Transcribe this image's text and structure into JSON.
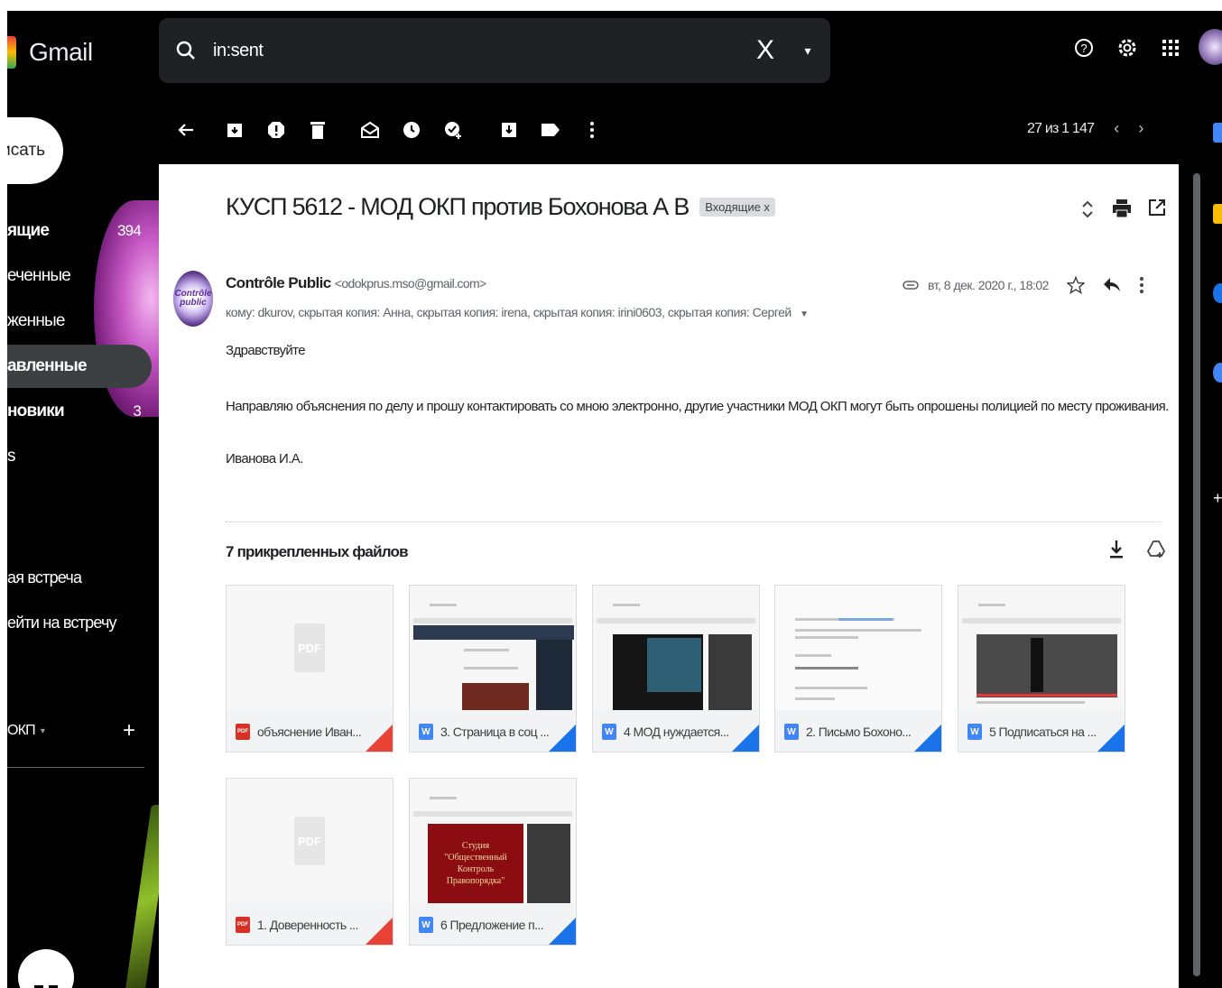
{
  "app": {
    "logo": "Gmail",
    "search": {
      "value": "in:sent",
      "clear": "X",
      "dropdown": "▾"
    }
  },
  "sidebar": {
    "compose": "исать",
    "items": [
      {
        "label": "ящие",
        "count": "394"
      },
      {
        "label": "еченные",
        "count": ""
      },
      {
        "label": "женные",
        "count": ""
      },
      {
        "label": "авленные",
        "count": ""
      },
      {
        "label": "новики",
        "count": "3"
      },
      {
        "label": "s",
        "count": ""
      }
    ],
    "meet": [
      "ая встреча",
      "ейти на встречу"
    ],
    "labels_section": {
      "label": "ОКП",
      "caret": "▾",
      "add": "+"
    }
  },
  "toolbar": {
    "pager_text": "27 из 1 147",
    "prev": "‹",
    "next": "›"
  },
  "email": {
    "subject": "КУСП 5612 - МОД ОКП против Бохонова А В",
    "label_chip": "Входящие x",
    "sender_avatar_text": [
      "Contrôle",
      "public"
    ],
    "sender_name": "Contrôle Public",
    "sender_email": "<odokprus.mso@gmail.com>",
    "to_line": "кому: dkurov, скрытая копия: Анна, скрытая копия: irena, скрытая копия: irini0603, скрытая копия: Сергей",
    "date": "вт, 8 дек. 2020 г., 18:02",
    "greeting": "Здравствуйте",
    "body": "Направляю объяснения по делу и прошу контактировать со мною электронно, другие участники МОД ОКП могут быть опрошены полицией по месту проживания.",
    "signature": "Иванова И.А."
  },
  "attachments": {
    "title": "7 прикрепленных файлов",
    "items": [
      {
        "name": "объяснение Иван...",
        "type": "pdf",
        "badge": "PDF",
        "preview": "pdf"
      },
      {
        "name": "3. Страница в соц ...",
        "type": "doc",
        "badge": "W",
        "preview": "screen-social"
      },
      {
        "name": "4 МОД нуждается...",
        "type": "doc",
        "badge": "W",
        "preview": "screen-video"
      },
      {
        "name": "2. Письмо Бохоно...",
        "type": "doc",
        "badge": "W",
        "preview": "text"
      },
      {
        "name": "5 Подписаться на ...",
        "type": "doc",
        "badge": "W",
        "preview": "screen-video2"
      },
      {
        "name": "1. Доверенность ...",
        "type": "pdf",
        "badge": "PDF",
        "preview": "pdf"
      },
      {
        "name": "6 Предложение п...",
        "type": "doc",
        "badge": "W",
        "preview": "screen-studio"
      }
    ],
    "pdf_ghost": "PDF",
    "studio_text": [
      "Студия",
      "\"Общественный",
      "Контроль",
      "Правопорядка\""
    ]
  },
  "colors": {
    "background": "#000000",
    "panel": "#ffffff",
    "pdf_red": "#e84234",
    "doc_blue": "#1a73e8"
  }
}
